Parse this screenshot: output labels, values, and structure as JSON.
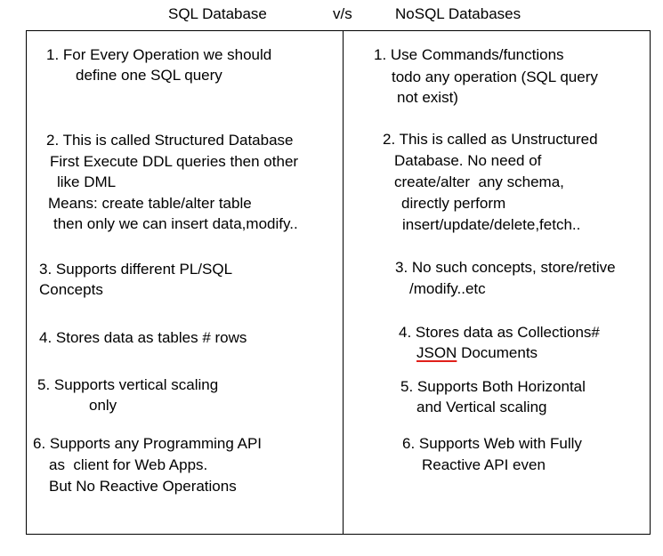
{
  "header": {
    "left": "SQL Database",
    "mid": "v/s",
    "right": "NoSQL Databases"
  },
  "left": [
    "1. For Every Operation we should",
    "define one SQL query",
    "2. This is called Structured Database",
    "First Execute DDL queries then other",
    "like DML",
    "Means: create table/alter table",
    "then only we can insert data,modify..",
    "3. Supports different PL/SQL",
    "Concepts",
    "4. Stores data as tables # rows",
    "5. Supports vertical scaling",
    "only",
    "6. Supports any Programming API",
    "as  client for Web Apps.",
    "But No Reactive Operations"
  ],
  "right": [
    "1. Use Commands/functions",
    "todo any operation (SQL query",
    "not exist)",
    "2. This is called as Unstructured",
    "Database. No need of",
    "create/alter  any schema,",
    "directly perform",
    "insert/update/delete,fetch..",
    "3. No such concepts, store/retive",
    "/modify..etc",
    "4. Stores data as Collections#",
    "JSON",
    " Documents",
    "5. Supports Both Horizontal",
    "and Vertical scaling",
    "6. Supports Web with Fully",
    "Reactive API even"
  ],
  "colors": {
    "underline": "#e0201a"
  }
}
